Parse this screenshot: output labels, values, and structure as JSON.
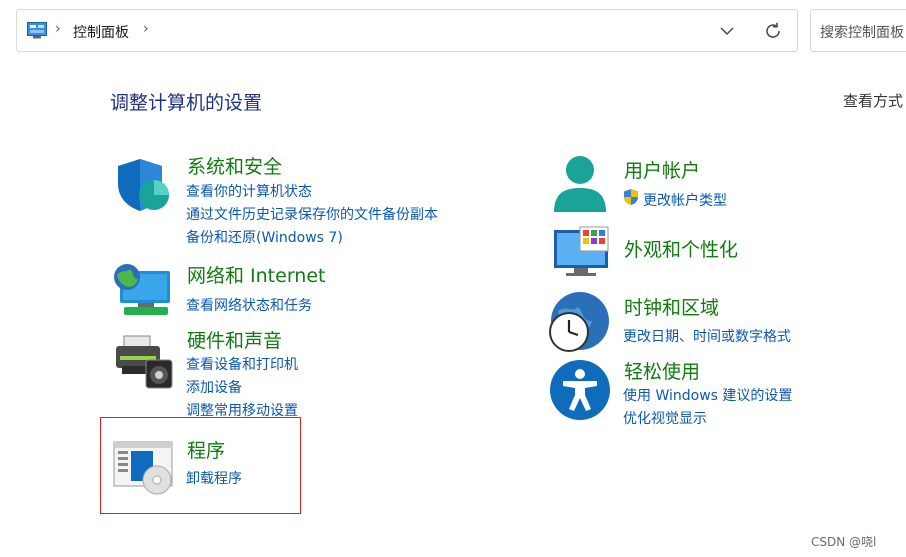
{
  "address_bar": {
    "crumb": "控制面板",
    "sep1": "›",
    "sep2": "›"
  },
  "search": {
    "placeholder": "搜索控制面板"
  },
  "page_title": "调整计算机的设置",
  "view_by": "查看方式",
  "left_categories": [
    {
      "title": "系统和安全",
      "links": [
        "查看你的计算机状态",
        "通过文件历史记录保存你的文件备份副本",
        "备份和还原(Windows 7)"
      ]
    },
    {
      "title": "网络和 Internet",
      "links": [
        "查看网络状态和任务"
      ]
    },
    {
      "title": "硬件和声音",
      "links": [
        "查看设备和打印机",
        "添加设备",
        "调整常用移动设置"
      ]
    },
    {
      "title": "程序",
      "links": [
        "卸载程序"
      ]
    }
  ],
  "right_categories": [
    {
      "title": "用户帐户",
      "links": [
        "更改帐户类型"
      ]
    },
    {
      "title": "外观和个性化",
      "links": []
    },
    {
      "title": "时钟和区域",
      "links": [
        "更改日期、时间或数字格式"
      ]
    },
    {
      "title": "轻松使用",
      "links": [
        "使用 Windows 建议的设置",
        "优化视觉显示"
      ]
    }
  ],
  "watermark": "CSDN @哓l",
  "colors": {
    "title_green": "#107c10",
    "link_blue": "#0a58b4",
    "heading_blue": "#1e3287",
    "highlight_red": "#e02020"
  }
}
